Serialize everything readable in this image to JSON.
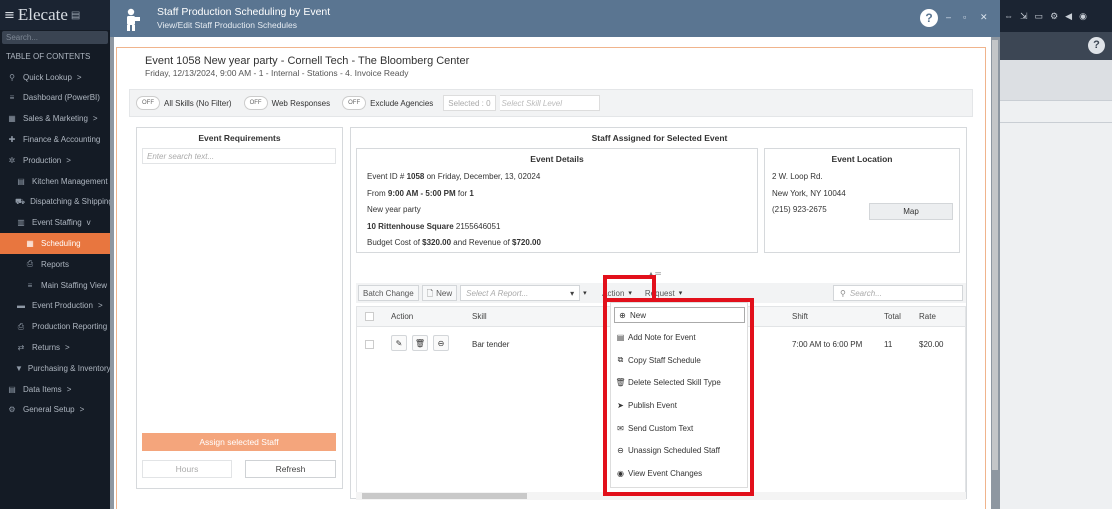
{
  "sidebar": {
    "logo": "Elecate",
    "search_placeholder": "Search...",
    "toc_label": "TABLE OF CONTENTS",
    "items": [
      {
        "label": "Quick Lookup",
        "level": 1,
        "icon": "search-icon",
        "caret": ">"
      },
      {
        "label": "Dashboard (PowerBI)",
        "level": 1,
        "icon": "dashboard-icon",
        "caret": ""
      },
      {
        "label": "Sales & Marketing",
        "level": 1,
        "icon": "sales-icon",
        "caret": ">"
      },
      {
        "label": "Finance & Accounting",
        "level": 1,
        "icon": "finance-icon",
        "caret": ""
      },
      {
        "label": "Production",
        "level": 1,
        "icon": "production-icon",
        "caret": ">"
      },
      {
        "label": "Kitchen Management",
        "level": 2,
        "icon": "kitchen-icon",
        "caret": ""
      },
      {
        "label": "Dispatching & Shipping",
        "level": 2,
        "icon": "truck-icon",
        "caret": ""
      },
      {
        "label": "Event Staffing",
        "level": 2,
        "icon": "staffing-icon",
        "caret": "v"
      },
      {
        "label": "Scheduling",
        "level": 3,
        "icon": "calendar-icon",
        "caret": "",
        "active": true
      },
      {
        "label": "Reports",
        "level": 3,
        "icon": "print-icon",
        "caret": ""
      },
      {
        "label": "Main Staffing View",
        "level": 3,
        "icon": "list-icon",
        "caret": ""
      },
      {
        "label": "Event Production",
        "level": 2,
        "icon": "event-production-icon",
        "caret": ">"
      },
      {
        "label": "Production Reporting",
        "level": 2,
        "icon": "print-icon",
        "caret": ""
      },
      {
        "label": "Returns",
        "level": 2,
        "icon": "returns-icon",
        "caret": ">"
      },
      {
        "label": "Purchasing & Inventory",
        "level": 2,
        "icon": "cart-icon",
        "caret": ""
      },
      {
        "label": "Data Items",
        "level": 1,
        "icon": "data-icon",
        "caret": ">"
      },
      {
        "label": "General Setup",
        "level": 1,
        "icon": "setup-icon",
        "caret": ">"
      }
    ]
  },
  "modal": {
    "title": "Staff Production Scheduling by Event",
    "subtitle": "View/Edit Staff Production Schedules",
    "help": "?",
    "event_title": "Event 1058 New year party - Cornell Tech - The Bloomberg Center",
    "event_subtitle": "Friday, 12/13/2024, 9:00 AM - 1 - Internal - Stations - 4. Invoice Ready"
  },
  "filters": {
    "toggle_off": "OFF",
    "all_skills": "All Skills (No Filter)",
    "web_responses": "Web Responses",
    "exclude_agencies": "Exclude Agencies",
    "selected": "Selected : 0",
    "skill_level_placeholder": "Select Skill Level"
  },
  "requirements": {
    "header": "Event Requirements",
    "search_placeholder": "Enter search text...",
    "assign_button": "Assign selected Staff",
    "hours_button": "Hours",
    "refresh_button": "Refresh"
  },
  "staff": {
    "header": "Staff Assigned for Selected Event",
    "details": {
      "header": "Event Details",
      "line1_pre": "Event ID # ",
      "line1_id": "1058",
      "line1_post": " on Friday, December, 13, 02024",
      "line2_pre": "From ",
      "line2_time": "9:00 AM - 5:00 PM",
      "line2_mid": " for ",
      "line2_count": "1",
      "line3": "New year party",
      "line4_addr": "10 Rittenhouse Square",
      "line4_phone": " 2155646051",
      "line5_pre": "Budget Cost of ",
      "line5_cost": "$320.00",
      "line5_mid": " and Revenue of ",
      "line5_rev": "$720.00"
    },
    "location": {
      "header": "Event Location",
      "street": "2 W. Loop Rd.",
      "city": "New York, NY 10044",
      "phone": "(215) 923-2675",
      "map_button": "Map"
    }
  },
  "toolbar": {
    "batch_change": "Batch Change",
    "new": "New",
    "report_placeholder": "Select A Report...",
    "action": "Action",
    "request": "Request",
    "search_placeholder": "Search..."
  },
  "grid": {
    "columns": [
      "Action",
      "Skill",
      "Shift",
      "Total",
      "Rate"
    ],
    "rows": [
      {
        "skill": "Bar tender",
        "shift": "7:00 AM to 6:00 PM",
        "total": "11",
        "rate": "$20.00"
      }
    ]
  },
  "action_menu": {
    "items": [
      {
        "label": "New",
        "icon": "plus-circle-icon"
      },
      {
        "label": "Add Note for Event",
        "icon": "note-icon"
      },
      {
        "label": "Copy Staff Schedule",
        "icon": "copy-icon"
      },
      {
        "label": "Delete Selected Skill Type",
        "icon": "trash-icon"
      },
      {
        "label": "Publish Event",
        "icon": "send-icon"
      },
      {
        "label": "Send Custom Text",
        "icon": "envelope-icon"
      },
      {
        "label": "Unassign Scheduled Staff",
        "icon": "unlink-icon"
      },
      {
        "label": "View Event Changes",
        "icon": "eye-icon"
      }
    ]
  },
  "colors": {
    "accent": "#e8763f",
    "highlight": "#e2101b",
    "header_bg": "#5a7591"
  }
}
